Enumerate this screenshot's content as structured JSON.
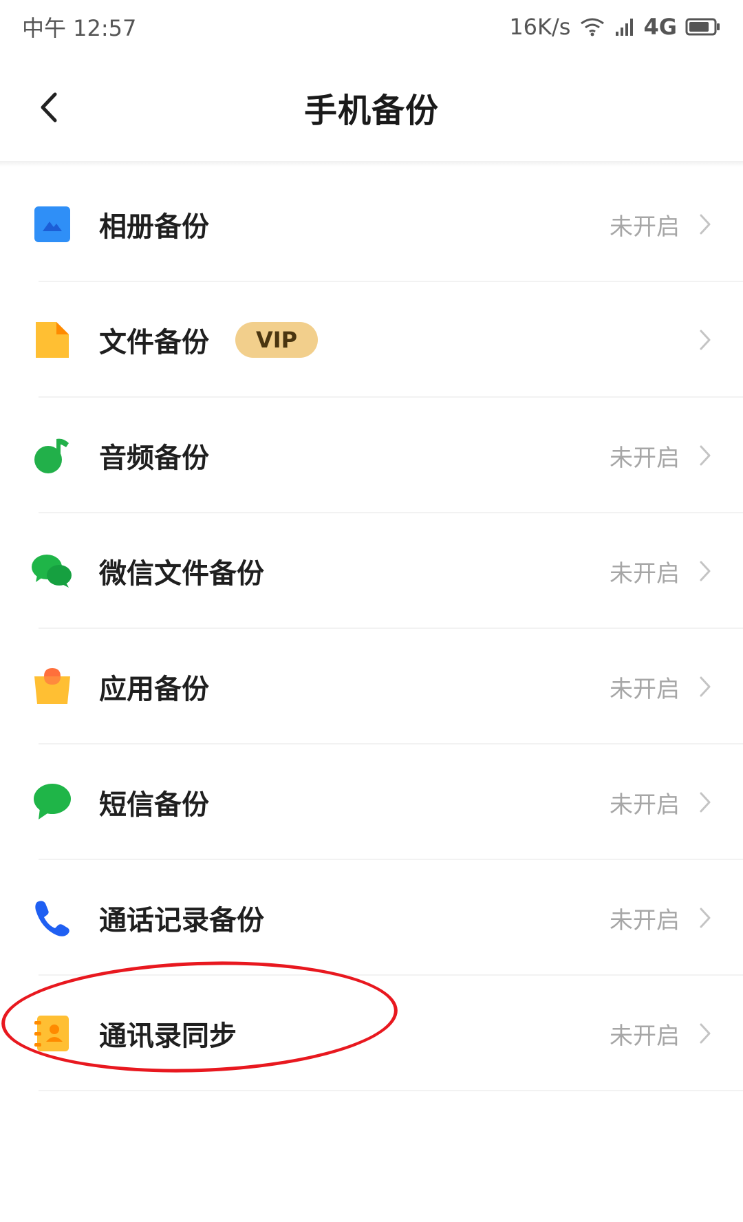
{
  "status_bar": {
    "time": "中午 12:57",
    "net_speed": "16K/s",
    "network": "4G"
  },
  "header": {
    "title": "手机备份"
  },
  "items": [
    {
      "label": "相册备份",
      "status": "未开启",
      "icon": "gallery-icon",
      "color": "#2f8ff7"
    },
    {
      "label": "文件备份",
      "status": "",
      "badge": "VIP",
      "icon": "file-icon",
      "color": "#ffbf33"
    },
    {
      "label": "音频备份",
      "status": "未开启",
      "icon": "music-note-icon",
      "color": "#22b04a"
    },
    {
      "label": "微信文件备份",
      "status": "未开启",
      "icon": "wechat-icon",
      "color": "#1fb548"
    },
    {
      "label": "应用备份",
      "status": "未开启",
      "icon": "app-bag-icon",
      "color": "#ffbf33"
    },
    {
      "label": "短信备份",
      "status": "未开启",
      "icon": "message-icon",
      "color": "#1fb548"
    },
    {
      "label": "通话记录备份",
      "status": "未开启",
      "icon": "phone-icon",
      "color": "#1f5ff2"
    },
    {
      "label": "通讯录同步",
      "status": "未开启",
      "icon": "contacts-book-icon",
      "color": "#ffbf33"
    }
  ],
  "colors": {
    "accent_red_annotation": "#e8181f",
    "status_text": "#a6a6a6",
    "vip_bg": "#f2cf8c"
  }
}
